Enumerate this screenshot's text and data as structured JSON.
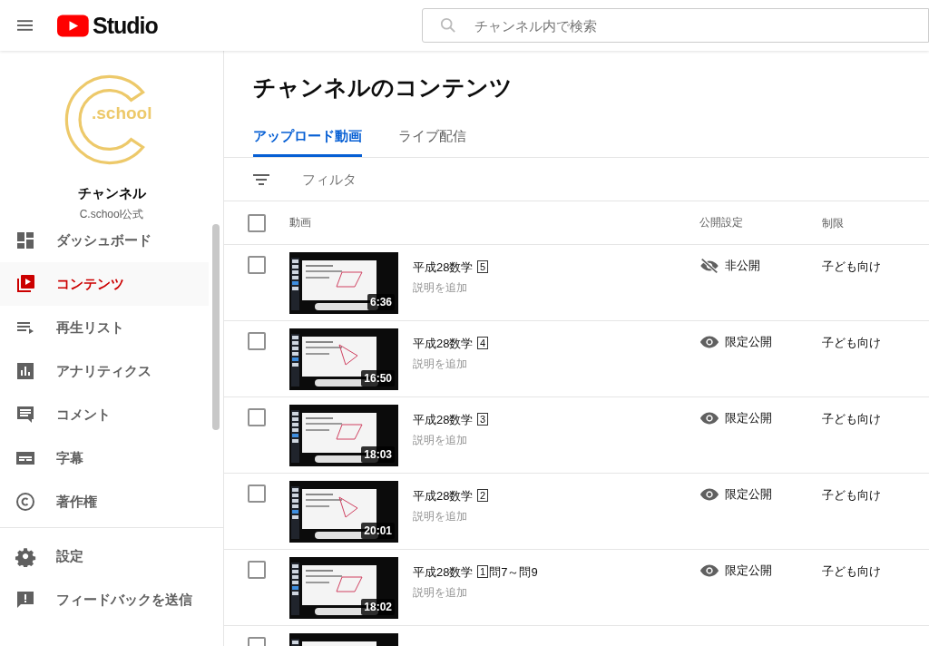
{
  "header": {
    "logo_text": "Studio",
    "search": {
      "placeholder": "チャンネル内で検索"
    }
  },
  "channel": {
    "logo_text": ".school",
    "name": "チャンネル",
    "handle": "C.school公式"
  },
  "nav": [
    {
      "kind": "dashboard",
      "label": "ダッシュボード",
      "selected": false
    },
    {
      "kind": "content",
      "label": "コンテンツ",
      "selected": true
    },
    {
      "kind": "playlist",
      "label": "再生リスト",
      "selected": false
    },
    {
      "kind": "analytics",
      "label": "アナリティクス",
      "selected": false
    },
    {
      "kind": "comments",
      "label": "コメント",
      "selected": false
    },
    {
      "kind": "subtitles",
      "label": "字幕",
      "selected": false
    },
    {
      "kind": "copyright",
      "label": "著作権",
      "selected": false
    }
  ],
  "nav_bottom": [
    {
      "kind": "settings",
      "label": "設定",
      "selected": false
    },
    {
      "kind": "feedback",
      "label": "フィードバックを送信",
      "selected": false
    }
  ],
  "page_title": "チャンネルのコンテンツ",
  "tabs": [
    {
      "label": "アップロード動画",
      "selected": true
    },
    {
      "label": "ライブ配信",
      "selected": false
    }
  ],
  "filter": {
    "placeholder": "フィルタ"
  },
  "table": {
    "select_all": {
      "checked": false
    },
    "columns": [
      "動画",
      "公開設定",
      "制限"
    ],
    "rows": [
      {
        "checked": false,
        "title": "平成28数学",
        "number": "5",
        "description": "説明を追加",
        "duration": "6:36",
        "visibility": {
          "kind": "private",
          "label": "非公開"
        },
        "restriction": "子ども向け"
      },
      {
        "checked": false,
        "title": "平成28数学",
        "number": "4",
        "description": "説明を追加",
        "duration": "16:50",
        "visibility": {
          "kind": "unlisted",
          "label": "限定公開"
        },
        "restriction": "子ども向け"
      },
      {
        "checked": false,
        "title": "平成28数学",
        "number": "3",
        "description": "説明を追加",
        "duration": "18:03",
        "visibility": {
          "kind": "unlisted",
          "label": "限定公開"
        },
        "restriction": "子ども向け"
      },
      {
        "checked": false,
        "title": "平成28数学",
        "number": "2",
        "description": "説明を追加",
        "duration": "20:01",
        "visibility": {
          "kind": "unlisted",
          "label": "限定公開"
        },
        "restriction": "子ども向け"
      },
      {
        "checked": false,
        "title": "平成28数学",
        "number": "1",
        "suffix": "問7～問9",
        "description": "説明を追加",
        "duration": "18:02",
        "visibility": {
          "kind": "unlisted",
          "label": "限定公開"
        },
        "restriction": "子ども向け"
      },
      {
        "checked": false
      }
    ]
  }
}
